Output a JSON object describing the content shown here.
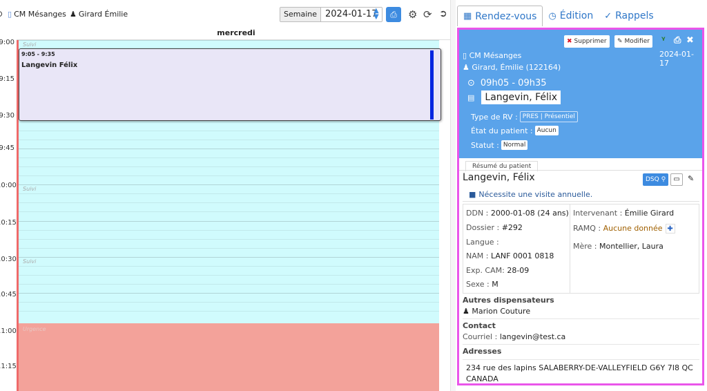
{
  "toolbar": {
    "location": "CM Mésanges",
    "provider": "Girard Émilie",
    "view_label": "Semaine",
    "date": "2024-01-17"
  },
  "calendar": {
    "day": "mercredi",
    "times": [
      "9:00",
      "9:15",
      "9:30",
      "9:45",
      "10:00",
      "10:15",
      "10:30",
      "10:45",
      "11:00",
      "11:15"
    ],
    "slot_tags": {
      "suivi": "Suivi",
      "urgence": "Urgence"
    },
    "appointment": {
      "time": "9:05 - 9:35",
      "patient": "Langevin Félix"
    }
  },
  "tabs": [
    {
      "label": "Rendez-vous",
      "icon": "calendar-icon"
    },
    {
      "label": "Édition",
      "icon": "clock-icon"
    },
    {
      "label": "Rappels",
      "icon": "check-circle-icon"
    }
  ],
  "appointment_detail": {
    "delete_label": "Supprimer",
    "edit_label": "Modifier",
    "date": "2024-01-17",
    "location": "CM Mésanges",
    "provider": "Girard, Émilie (122164)",
    "time_range": "09h05 - 09h35",
    "patient": "Langevin, Félix",
    "type_label": "Type de RV :",
    "type_value": "PRES | Présentiel",
    "etat_label": "État du patient :",
    "etat_value": "Aucun",
    "statut_label": "Statut :",
    "statut_value": "Normal"
  },
  "summary": {
    "tab_label": "Résumé du patient",
    "name": "Langevin, Félix",
    "dsq_label": "DSQ",
    "note": "Nécessite une visite annuelle.",
    "ddn_k": "DDN :",
    "ddn_v": "2000-01-08 (24 ans)",
    "dossier_k": "Dossier :",
    "dossier_v": "#292",
    "langue_k": "Langue :",
    "nam_k": "NAM :",
    "nam_v": "LANF 0001 0818",
    "exp_k": "Exp. CAM:",
    "exp_v": "28-09",
    "sexe_k": "Sexe :",
    "sexe_v": "M",
    "intervenant_k": "Intervenant :",
    "intervenant_v": "Émilie Girard",
    "ramq_k": "RAMQ :",
    "ramq_v": "Aucune donnée",
    "mere_k": "Mère :",
    "mere_v": "Montellier, Laura",
    "autres_h": "Autres dispensateurs",
    "autres_v": "Marion Couture",
    "contact_h": "Contact",
    "courriel_k": "Courriel :",
    "courriel_v": "langevin@test.ca",
    "adresses_h": "Adresses",
    "adresse_v": "234 rue des lapins SALABERRY-DE-VALLEYFIELD G6Y 7I8 QC CANADA"
  }
}
